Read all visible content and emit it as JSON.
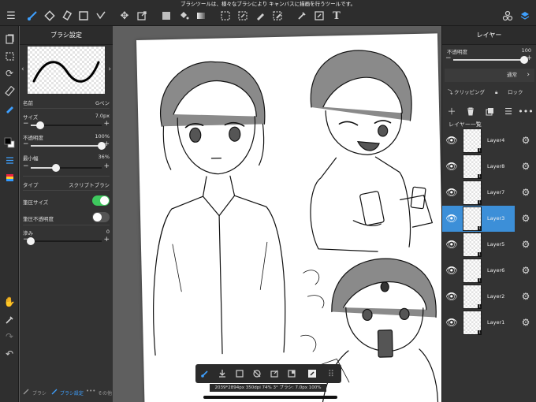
{
  "tooltip": "ブラシツールは、様々なブラシにより キャンバスに描画を行うツールです。",
  "topbar": {
    "icons": [
      "menu-icon",
      "brush-tool-icon",
      "eraser-tool-icon",
      "marker-icon",
      "select-rect-icon",
      "wand-icon",
      "move-icon",
      "transform-icon",
      "fill-icon",
      "bucket-icon",
      "gradient-icon",
      "lasso-select-icon",
      "magic-select-icon",
      "pen-select-icon",
      "eraser-select-icon",
      "eyedropper-icon",
      "text-icon",
      "materials-icon",
      "layers-icon"
    ]
  },
  "brush_panel": {
    "title": "ブラシ設定",
    "name_label": "名前",
    "name_value": "Gペン",
    "size_label": "サイズ",
    "size_value": "7.0px",
    "size_level": 0.13,
    "opacity_label": "不透明度",
    "opacity_value": "100%",
    "opacity_level": 1.0,
    "min_width_label": "最小幅",
    "min_width_value": "36%",
    "min_width_level": 0.36,
    "type_label": "タイプ",
    "type_value": "スクリプトブラシ",
    "pressure_size_label": "筆圧サイズ",
    "pressure_size_on": true,
    "pressure_opacity_label": "筆圧不透明度",
    "pressure_opacity_on": false,
    "blur_label": "滲み",
    "blur_value": "0",
    "blur_level": 0.0,
    "bottom_brush": "ブラシ",
    "bottom_settings": "ブラシ設定",
    "bottom_other": "その他"
  },
  "status_bar": "2039*2894px 350dpi 74% 3° ブラシ: 7.0px 100%",
  "layer_panel": {
    "title": "レイヤー",
    "opacity_label": "不透明度",
    "opacity_value": "100",
    "opacity_level": 1.0,
    "blend_mode": "通常",
    "clipping_label": "クリッピング",
    "lock_label": "ロック",
    "list_label": "レイヤー一覧",
    "layers": [
      {
        "name": "Layer4",
        "selected": false
      },
      {
        "name": "Layer8",
        "selected": false
      },
      {
        "name": "Layer7",
        "selected": false
      },
      {
        "name": "Layer3",
        "selected": true
      },
      {
        "name": "Layer5",
        "selected": false
      },
      {
        "name": "Layer6",
        "selected": false
      },
      {
        "name": "Layer2",
        "selected": false
      },
      {
        "name": "Layer1",
        "selected": false
      }
    ]
  },
  "colors": {
    "accent": "#3ea0ff",
    "selected_layer": "#3c8fd8",
    "toggle_on": "#3ec95e",
    "panel": "#333333",
    "canvas_bg": "#5f5f5f"
  }
}
